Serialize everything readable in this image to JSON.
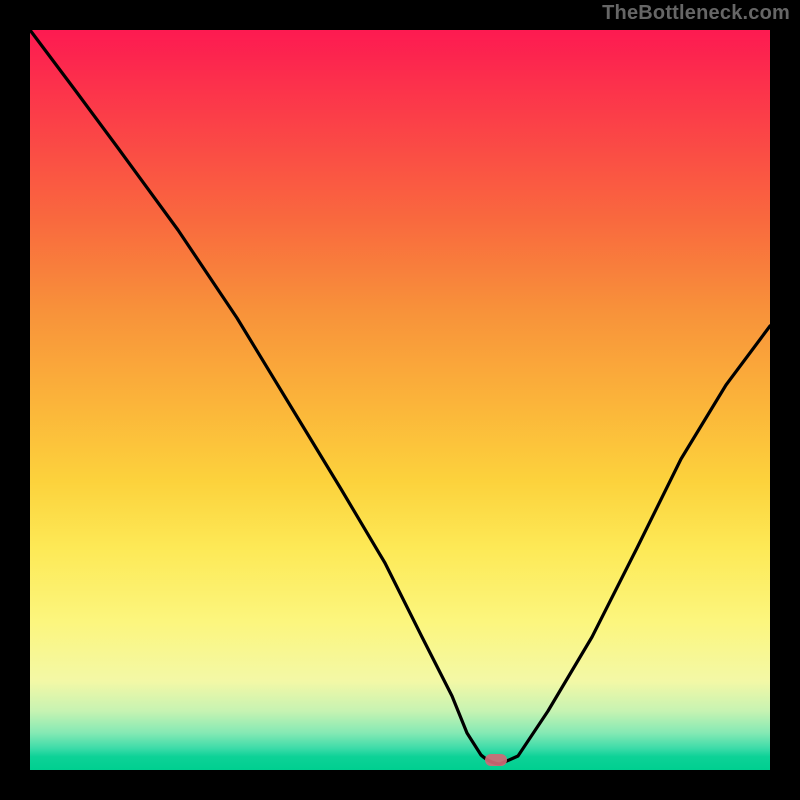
{
  "watermark": "TheBottleneck.com",
  "colors": {
    "frame": "#000000",
    "curve": "#000000",
    "marker": "#cf6a76",
    "gradient_top": "#fd1a51",
    "gradient_bottom": "#00cf90"
  },
  "chart_data": {
    "type": "line",
    "title": "",
    "xlabel": "",
    "ylabel": "",
    "xlim": [
      0,
      100
    ],
    "ylim": [
      0,
      100
    ],
    "x": [
      0,
      6,
      12,
      20,
      28,
      36,
      42,
      48,
      53,
      57,
      59,
      61,
      63,
      66,
      70,
      76,
      82,
      88,
      94,
      100
    ],
    "values": [
      100,
      92,
      84,
      73,
      61,
      48,
      38,
      28,
      18,
      10,
      5,
      2,
      1,
      2,
      8,
      18,
      30,
      42,
      52,
      60
    ],
    "minimum_x": 62,
    "minimum_y": 1,
    "note": "Values read as percentage of plot height from bottom; no axis ticks or labels visible."
  }
}
